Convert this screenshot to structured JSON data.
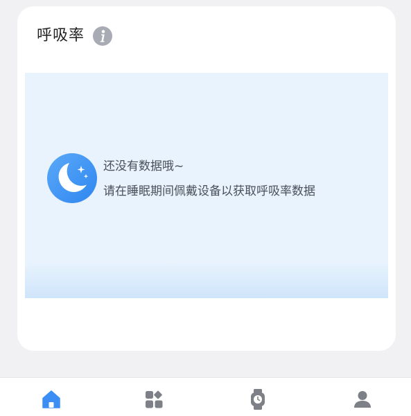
{
  "card": {
    "title": "呼吸率",
    "info_icon": "info-icon"
  },
  "empty_state": {
    "icon": "moon-stars-icon",
    "title": "还没有数据哦~",
    "description": "请在睡眠期间佩戴设备以获取呼吸率数据"
  },
  "bottom_nav": {
    "items": [
      {
        "icon": "home-icon",
        "active": true
      },
      {
        "icon": "apps-icon",
        "active": false
      },
      {
        "icon": "watch-icon",
        "active": false
      },
      {
        "icon": "profile-icon",
        "active": false
      }
    ]
  },
  "colors": {
    "accent": "#3c8ef5",
    "inactive_icon": "#7d8087",
    "panel_bg": "#e8f3fd",
    "page_bg": "#f1f1f3"
  }
}
